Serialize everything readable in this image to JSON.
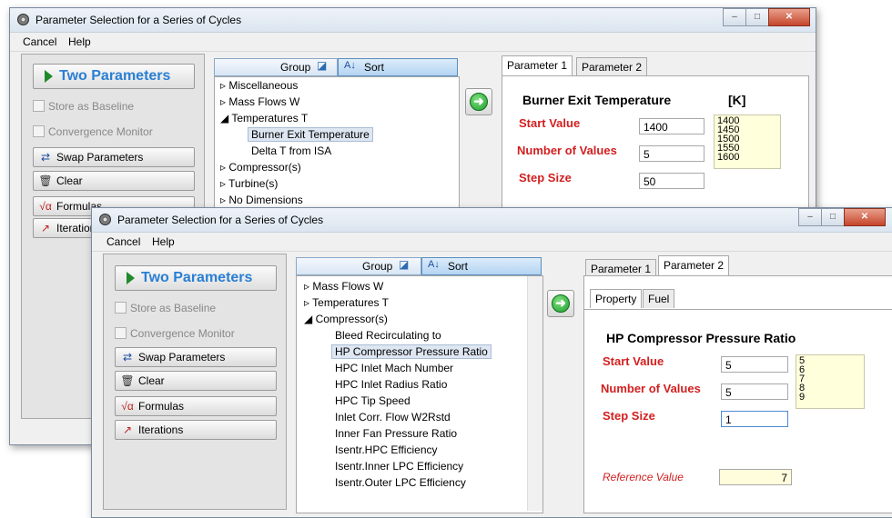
{
  "back_window": {
    "title": "Parameter Selection for a Series of Cycles",
    "menu": [
      "Cancel",
      "Help"
    ],
    "window_buttons": [
      "–",
      "□",
      "✕"
    ],
    "left": {
      "mode_button": "Two Parameters",
      "store_baseline": "Store as Baseline",
      "convergence_monitor": "Convergence Monitor",
      "swap": "Swap Parameters",
      "clear": "Clear",
      "formulas": "Formulas",
      "iterations": "Iteration"
    },
    "tree_header": {
      "group": "Group",
      "sort": "Sort"
    },
    "tree": [
      "Miscellaneous",
      "Mass Flows W",
      "Temperatures T",
      "Burner Exit Temperature",
      "Delta T from ISA",
      "Compressor(s)",
      "Turbine(s)",
      "No Dimensions"
    ],
    "tabs": [
      "Parameter 1",
      "Parameter 2"
    ],
    "param": {
      "name": "Burner Exit Temperature",
      "unit": "[K]",
      "start_label": "Start Value",
      "start_value": "1400",
      "count_label": "Number of Values",
      "count_value": "5",
      "step_label": "Step Size",
      "step_value": "50",
      "values": [
        "1400",
        "1450",
        "1500",
        "1550",
        "1600"
      ]
    }
  },
  "front_window": {
    "title": "Parameter Selection for a Series of Cycles",
    "menu": [
      "Cancel",
      "Help"
    ],
    "window_buttons": [
      "–",
      "□",
      "✕"
    ],
    "left": {
      "mode_button": "Two Parameters",
      "store_baseline": "Store as Baseline",
      "convergence_monitor": "Convergence Monitor",
      "swap": "Swap Parameters",
      "clear": "Clear",
      "formulas": "Formulas",
      "iterations": "Iterations"
    },
    "tree_header": {
      "group": "Group",
      "sort": "Sort"
    },
    "tree": [
      "Mass Flows W",
      "Temperatures T",
      "Compressor(s)",
      "Bleed Recirculating to",
      "HP Compressor Pressure Ratio",
      "HPC Inlet Mach Number",
      "HPC Inlet Radius Ratio",
      "HPC Tip Speed",
      "Inlet Corr. Flow W2Rstd",
      "Inner Fan Pressure Ratio",
      "Isentr.HPC Efficiency",
      "Isentr.Inner LPC Efficiency",
      "Isentr.Outer LPC Efficiency"
    ],
    "tabs": [
      "Parameter 1",
      "Parameter 2"
    ],
    "subtabs": [
      "Property",
      "Fuel"
    ],
    "param": {
      "name": "HP Compressor Pressure Ratio",
      "start_label": "Start Value",
      "start_value": "5",
      "count_label": "Number of Values",
      "count_value": "5",
      "step_label": "Step Size",
      "step_value": "1",
      "values": [
        "5",
        "6",
        "7",
        "8",
        "9"
      ],
      "ref_label": "Reference Value",
      "ref_value": "7"
    }
  }
}
